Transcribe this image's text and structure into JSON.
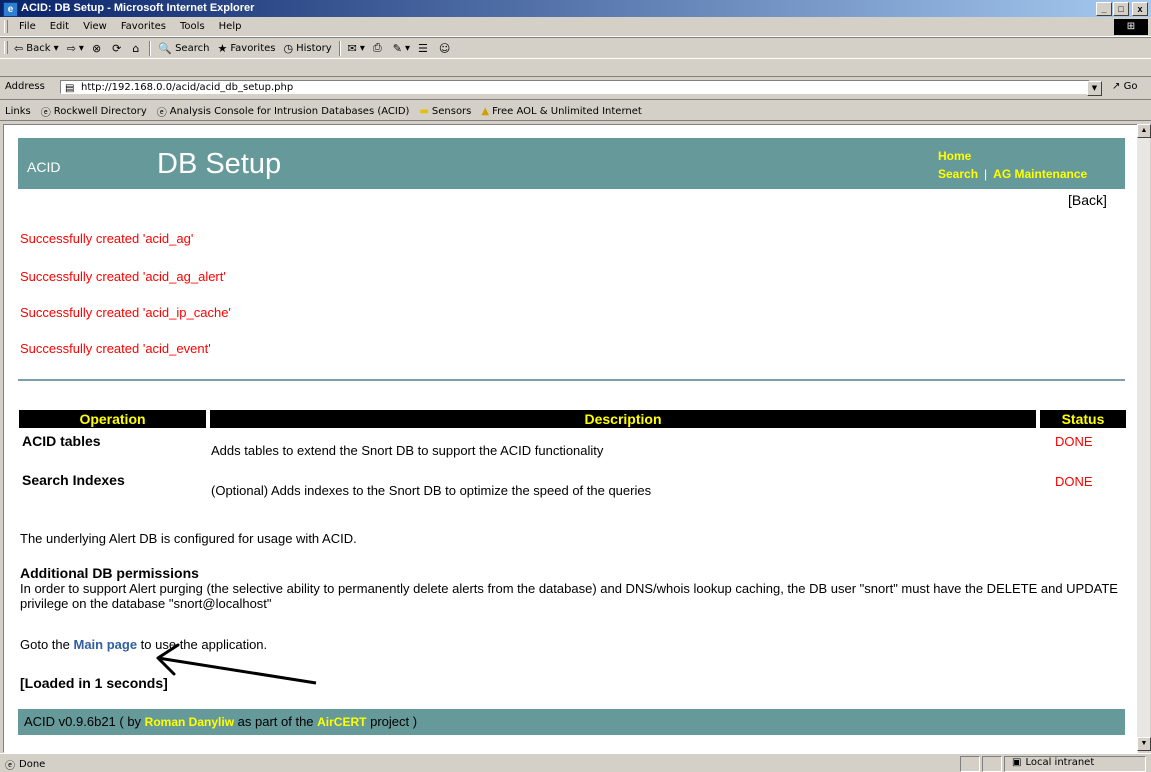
{
  "window": {
    "title": "ACID: DB Setup - Microsoft Internet Explorer",
    "buttons": [
      "_",
      "□",
      "x"
    ]
  },
  "menu": [
    "File",
    "Edit",
    "View",
    "Favorites",
    "Tools",
    "Help"
  ],
  "toolbar": {
    "back": "Back",
    "search": "Search",
    "favorites": "Favorites",
    "history": "History"
  },
  "address": {
    "label": "Address",
    "url": "http://192.168.0.0/acid/acid_db_setup.php",
    "go": "Go"
  },
  "links_bar": {
    "label": "Links",
    "items": [
      "Rockwell Directory",
      "Analysis Console for Intrusion Databases (ACID)",
      "Sensors",
      "Free AOL & Unlimited Internet"
    ]
  },
  "header": {
    "app_name": "ACID",
    "page_title": "DB Setup",
    "links": {
      "home": "Home",
      "search": "Search",
      "sep": "|",
      "ag_maintenance": "AG Maintenance"
    }
  },
  "back_link": "[Back]",
  "messages": [
    "Successfully created 'acid_ag'",
    "Successfully created 'acid_ag_alert'",
    "Successfully created 'acid_ip_cache'",
    "Successfully created 'acid_event'"
  ],
  "operations": {
    "headers": [
      "Operation",
      "Description",
      "Status"
    ],
    "rows": [
      {
        "name": "ACID tables",
        "description": "Adds tables to extend the Snort DB to support the ACID functionality",
        "status": "DONE"
      },
      {
        "name": "Search Indexes",
        "description": "(Optional) Adds indexes to the Snort DB to optimize the speed of the queries",
        "status": "DONE"
      }
    ]
  },
  "configured_text": "The underlying Alert DB is configured for usage with ACID.",
  "permissions": {
    "heading": "Additional DB permissions",
    "body": "In order to support Alert purging (the selective ability to permanently delete alerts from the database) and DNS/whois lookup caching, the DB user \"snort\" must have the DELETE and UPDATE privilege on the database \"snort@localhost\""
  },
  "goto": {
    "prefix": "Goto the ",
    "link": "Main page",
    "suffix": " to use the application."
  },
  "loaded": "[Loaded in 1 seconds]",
  "footer": {
    "prefix": "ACID v0.9.6b21 ( by ",
    "author": "Roman Danyliw",
    "middle": " as part of the ",
    "project": "AirCERT",
    "suffix": " project )"
  },
  "status_bar": {
    "text": "Done",
    "zone": "Local intranet"
  },
  "colors": {
    "header_bg": "#669999",
    "accent_link": "#ffff00",
    "error_red": "#ff0000"
  }
}
